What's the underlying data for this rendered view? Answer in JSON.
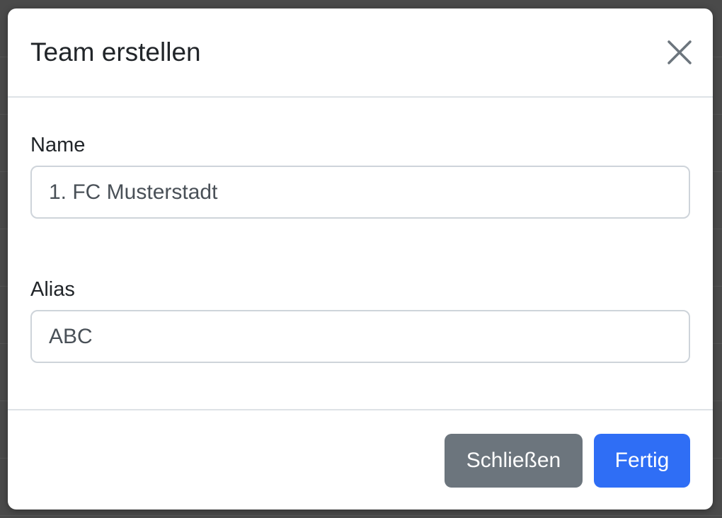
{
  "modal": {
    "title": "Team erstellen",
    "close_icon": "close-icon"
  },
  "form": {
    "name": {
      "label": "Name",
      "value": "1. FC Musterstadt"
    },
    "alias": {
      "label": "Alias",
      "value": "ABC"
    }
  },
  "footer": {
    "close_label": "Schließen",
    "done_label": "Fertig"
  },
  "colors": {
    "primary": "#2f6ef5",
    "secondary": "#6c757d",
    "border": "#ced4da",
    "text": "#212529"
  }
}
